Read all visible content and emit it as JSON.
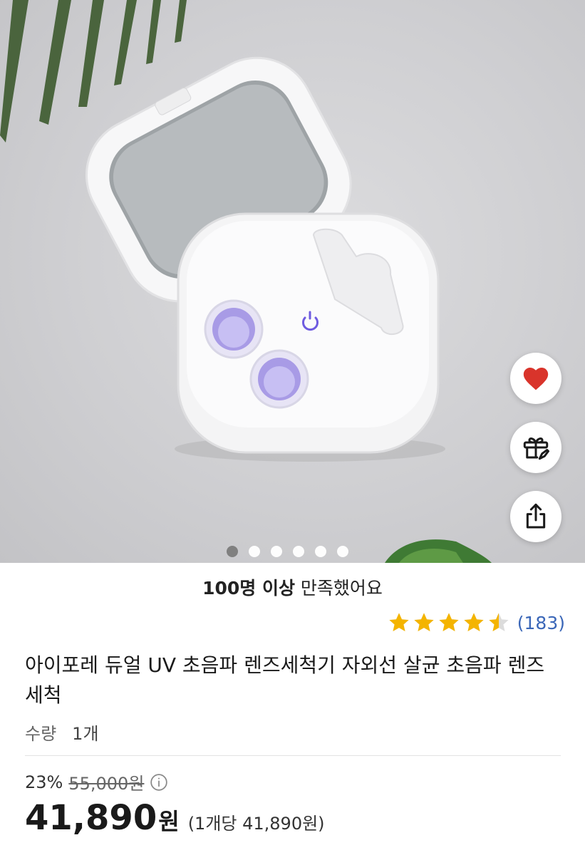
{
  "gallery": {
    "slide_count": 6,
    "active_index": 0
  },
  "actions": {
    "wishlist_icon": "heart-icon",
    "gift_icon": "gift-icon",
    "share_icon": "share-icon",
    "wishlist_color": "#d9342b"
  },
  "satisfaction": {
    "bold": "100명 이상",
    "rest": " 만족했어요"
  },
  "rating": {
    "score": 4.5,
    "max": 5,
    "count_label": "(183)",
    "star_color": "#f4b400"
  },
  "product": {
    "title": "아이포레 듀얼 UV 초음파 렌즈세척기 자외선 살균 초음파 렌즈 세척"
  },
  "quantity": {
    "label": "수량",
    "value": "1개"
  },
  "price": {
    "discount": "23%",
    "original": "55,000원",
    "final": "41,890",
    "currency": "원",
    "unit_price": "(1개당 41,890원)"
  }
}
